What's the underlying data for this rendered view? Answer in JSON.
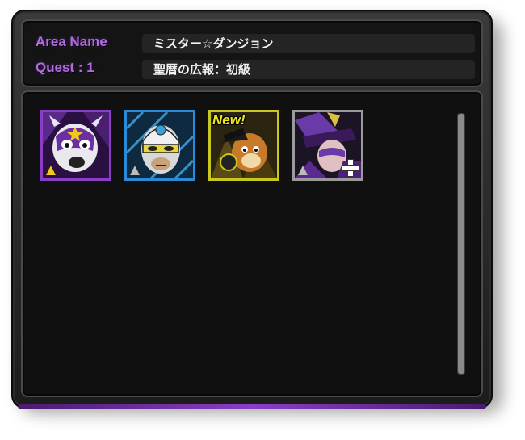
{
  "header": {
    "area_label": "Area Name",
    "area_value": "ミスター☆ダンジョン",
    "quest_label": "Quest : 1",
    "quest_value": "聖暦の広報：初級"
  },
  "cards": [
    {
      "name": "masked-dog-card",
      "frame_color": "#8a3ec8",
      "badge": "",
      "icon": "masked-dog-portrait"
    },
    {
      "name": "masked-hero-card",
      "frame_color": "#2a8ad8",
      "badge": "",
      "icon": "masked-hero-portrait"
    },
    {
      "name": "new-fox-card",
      "frame_color": "#c8c81e",
      "badge": "New!",
      "icon": "fox-portrait"
    },
    {
      "name": "purple-hat-card",
      "frame_color": "#9a9a9a",
      "badge": "",
      "icon": "purple-hat-portrait"
    }
  ],
  "colors": {
    "label": "#b36ee0",
    "accent": "#8a3ec8"
  }
}
